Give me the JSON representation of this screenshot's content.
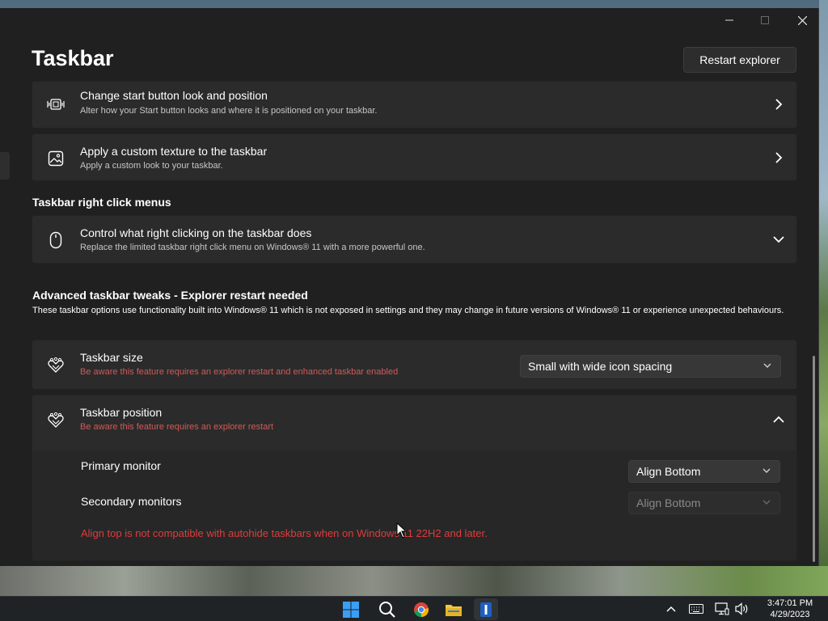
{
  "window": {
    "title": "Taskbar",
    "restart_label": "Restart explorer",
    "caption": {
      "minimize": "—",
      "maximize": "☐",
      "close": "✕"
    }
  },
  "cards": {
    "start_button": {
      "title": "Change start button look and position",
      "desc": "Alter how your Start button looks and where it is positioned on your taskbar.",
      "icon": "start-button-icon"
    },
    "texture": {
      "title": "Apply a custom texture to the taskbar",
      "desc": "Apply a custom look to your taskbar.",
      "icon": "image-icon"
    },
    "right_click": {
      "title": "Control what right clicking on the taskbar does",
      "desc": "Replace the limited taskbar right click menu on Windows® 11 with a more powerful one.",
      "icon": "mouse-icon"
    },
    "taskbar_size": {
      "title": "Taskbar size",
      "desc": "Be aware this feature requires an explorer restart and enhanced taskbar enabled",
      "value": "Small with wide icon spacing",
      "icon": "tweak-icon"
    },
    "taskbar_position": {
      "title": "Taskbar position",
      "desc": "Be aware this feature requires an explorer restart",
      "icon": "tweak-icon"
    }
  },
  "sections": {
    "right_click_header": "Taskbar right click menus",
    "advanced_header": "Advanced taskbar tweaks - Explorer restart needed",
    "advanced_desc": "These taskbar options use functionality built into Windows® 11 which is not exposed in settings and they may change in future versions of Windows® 11 or experience unexpected behaviours."
  },
  "position": {
    "primary_label": "Primary monitor",
    "primary_value": "Align Bottom",
    "secondary_label": "Secondary monitors",
    "secondary_value": "Align Bottom",
    "error": "Align top is not compatible with autohide taskbars when on Windows 11 22H2 and later."
  },
  "taskbar": {
    "apps": [
      "windows-start-icon",
      "search-icon",
      "chrome-icon",
      "file-explorer-icon",
      "app-icon"
    ],
    "tray": [
      "chevron-up-icon",
      "keyboard-icon",
      "network-icon",
      "volume-icon"
    ],
    "time": "3:47:01 PM",
    "date": "4/29/2023"
  },
  "colors": {
    "window_bg": "#202020",
    "card_bg": "#2b2b2b",
    "warning_text": "#d05a5a",
    "error_text": "#e03c3c"
  }
}
